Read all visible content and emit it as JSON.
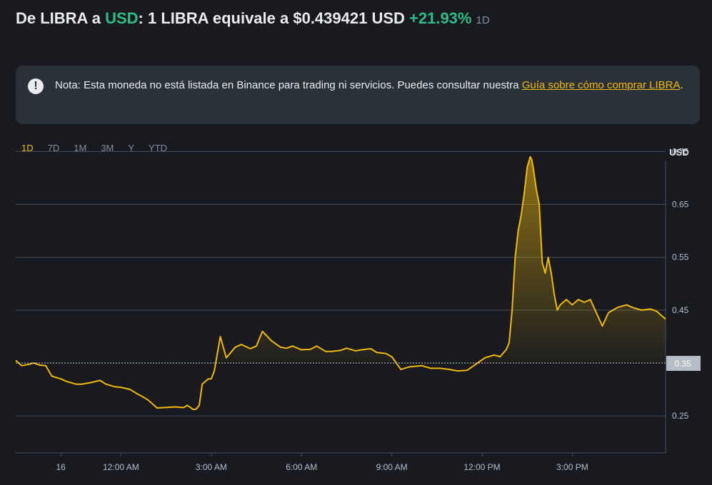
{
  "header": {
    "prefix": "De LIBRA a ",
    "quote": "USD",
    "middle": ": 1 LIBRA equivale a $0.439421 USD ",
    "change": "+21.93%",
    "period": "1D"
  },
  "note": {
    "text": "Nota: Esta moneda no está listada en Binance para trading ni servicios. Puedes consultar nuestra ",
    "link": "Guía sobre cómo comprar LIBRA",
    "suffix": "."
  },
  "tabs": [
    {
      "label": "1D",
      "active": true
    },
    {
      "label": "7D",
      "active": false
    },
    {
      "label": "1M",
      "active": false
    },
    {
      "label": "3M",
      "active": false
    },
    {
      "label": "Y",
      "active": false
    },
    {
      "label": "YTD",
      "active": false
    }
  ],
  "colors": {
    "line": "#f0b90b",
    "grid": "#474d57",
    "axis_text": "#b7bdc6",
    "positive": "#2ebd85",
    "baseline_label_bg": "#b7bdc6"
  },
  "chart_data": {
    "type": "area",
    "unit_label": "USD",
    "baseline": 0.35,
    "ylim": [
      0.18,
      0.76
    ],
    "xlim": [
      -3.5,
      18.1
    ],
    "yticks": [
      0.25,
      0.35,
      0.45,
      0.55,
      0.65,
      0.75
    ],
    "yticklabels": [
      "0.25",
      "0.35",
      "0.45",
      "0.55",
      "0.65",
      "0.75"
    ],
    "xticks": [
      -2,
      0,
      3,
      6,
      9,
      12,
      15
    ],
    "xticklabels": [
      "16",
      "12:00 AM",
      "3:00 AM",
      "6:00 AM",
      "9:00 AM",
      "12:00 PM",
      "3:00 PM"
    ],
    "grid": true,
    "series": [
      {
        "x": [
          -3.5,
          -3.3,
          -3.1,
          -2.9,
          -2.7,
          -2.5,
          -2.3,
          -2.0,
          -1.8,
          -1.5,
          -1.3,
          -1.0,
          -0.7,
          -0.5,
          -0.2,
          0.0,
          0.3,
          0.5,
          0.7,
          0.9,
          1.2,
          1.5,
          1.8,
          2.0,
          2.1,
          2.2,
          2.3,
          2.4,
          2.5,
          2.6,
          2.7,
          2.9,
          3.0,
          3.1,
          3.3,
          3.5,
          3.8,
          4.0,
          4.3,
          4.5,
          4.7,
          5.0,
          5.3,
          5.5,
          5.7,
          6.0,
          6.3,
          6.5,
          6.8,
          7.0,
          7.3,
          7.5,
          7.8,
          8.0,
          8.3,
          8.5,
          8.8,
          9.0,
          9.3,
          9.6,
          10.0,
          10.3,
          10.6,
          10.9,
          11.2,
          11.5,
          11.8,
          12.1,
          12.4,
          12.6,
          12.8,
          12.9,
          13.0,
          13.1,
          13.2,
          13.3,
          13.4,
          13.5,
          13.6,
          13.65,
          13.7,
          13.8,
          13.9,
          14.0,
          14.1,
          14.2,
          14.3,
          14.4,
          14.5,
          14.6,
          14.8,
          15.0,
          15.2,
          15.4,
          15.6,
          15.8,
          16.0,
          16.2,
          16.5,
          16.8,
          17.0,
          17.3,
          17.6,
          17.8,
          18.0,
          18.1
        ],
        "y": [
          0.355,
          0.345,
          0.347,
          0.35,
          0.346,
          0.345,
          0.325,
          0.32,
          0.315,
          0.31,
          0.31,
          0.313,
          0.317,
          0.31,
          0.305,
          0.304,
          0.3,
          0.293,
          0.287,
          0.28,
          0.265,
          0.266,
          0.267,
          0.266,
          0.266,
          0.27,
          0.266,
          0.262,
          0.263,
          0.27,
          0.31,
          0.32,
          0.32,
          0.335,
          0.4,
          0.36,
          0.38,
          0.385,
          0.377,
          0.382,
          0.41,
          0.392,
          0.38,
          0.378,
          0.382,
          0.375,
          0.376,
          0.382,
          0.372,
          0.372,
          0.374,
          0.378,
          0.373,
          0.375,
          0.377,
          0.37,
          0.368,
          0.362,
          0.338,
          0.343,
          0.345,
          0.34,
          0.34,
          0.338,
          0.335,
          0.336,
          0.348,
          0.36,
          0.365,
          0.362,
          0.375,
          0.388,
          0.45,
          0.55,
          0.6,
          0.63,
          0.67,
          0.72,
          0.74,
          0.735,
          0.72,
          0.68,
          0.65,
          0.54,
          0.52,
          0.55,
          0.52,
          0.48,
          0.45,
          0.46,
          0.47,
          0.46,
          0.47,
          0.465,
          0.47,
          0.445,
          0.42,
          0.445,
          0.455,
          0.46,
          0.455,
          0.45,
          0.452,
          0.448,
          0.438,
          0.433
        ]
      }
    ]
  }
}
